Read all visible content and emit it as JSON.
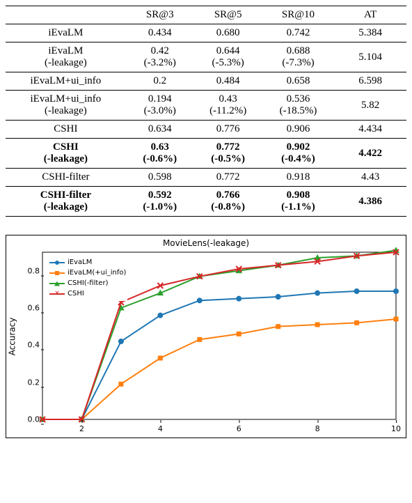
{
  "table": {
    "headers": [
      "",
      "SR@3",
      "SR@5",
      "SR@10",
      "AT"
    ],
    "rows": [
      {
        "label": "iEvaLM",
        "sub": "",
        "sr3": "0.434",
        "sr5": "0.680",
        "sr10": "0.742",
        "at": "5.384",
        "bold": false,
        "twoLine": false
      },
      {
        "label": "iEvaLM",
        "sub": "(-leakage)",
        "sr3": "0.42",
        "sr3d": "(-3.2%)",
        "sr5": "0.644",
        "sr5d": "(-5.3%)",
        "sr10": "0.688",
        "sr10d": "(-7.3%)",
        "at": "5.104",
        "bold": false,
        "twoLine": true
      },
      {
        "label": "iEvaLM+ui_info",
        "sub": "",
        "sr3": "0.2",
        "sr5": "0.484",
        "sr10": "0.658",
        "at": "6.598",
        "bold": false,
        "twoLine": false
      },
      {
        "label": "iEvaLM+ui_info",
        "sub": "(-leakage)",
        "sr3": "0.194",
        "sr3d": "(-3.0%)",
        "sr5": "0.43",
        "sr5d": "(-11.2%)",
        "sr10": "0.536",
        "sr10d": "(-18.5%)",
        "at": "5.82",
        "bold": false,
        "twoLine": true
      },
      {
        "label": "CSHI",
        "sub": "",
        "sr3": "0.634",
        "sr5": "0.776",
        "sr10": "0.906",
        "at": "4.434",
        "bold": false,
        "twoLine": false
      },
      {
        "label": "CSHI",
        "sub": "(-leakage)",
        "sr3": "0.63",
        "sr3d": "(-0.6%)",
        "sr5": "0.772",
        "sr5d": "(-0.5%)",
        "sr10": "0.902",
        "sr10d": "(-0.4%)",
        "at": "4.422",
        "bold": true,
        "twoLine": true
      },
      {
        "label": "CSHI-filter",
        "sub": "",
        "sr3": "0.598",
        "sr5": "0.772",
        "sr10": "0.918",
        "at": "4.43",
        "bold": false,
        "twoLine": false
      },
      {
        "label": "CSHI-filter",
        "sub": "(-leakage)",
        "sr3": "0.592",
        "sr3d": "(-1.0%)",
        "sr5": "0.766",
        "sr5d": "(-0.8%)",
        "sr10": "0.908",
        "sr10d": "(-1.1%)",
        "at": "4.386",
        "bold": true,
        "twoLine": true
      }
    ]
  },
  "chart_data": {
    "type": "line",
    "title": "MovieLens(-leakage)",
    "xlabel": "",
    "ylabel": "Accuracy",
    "xlim": [
      1,
      10
    ],
    "ylim": [
      0.0,
      0.9
    ],
    "xticks": [
      2,
      4,
      6,
      8,
      10
    ],
    "yticks": [
      0.0,
      0.2,
      0.4,
      0.6,
      0.8
    ],
    "x": [
      1,
      2,
      3,
      4,
      5,
      6,
      7,
      8,
      9,
      10
    ],
    "series": [
      {
        "name": "iEvaLM",
        "color": "#1f77b4",
        "marker": "circle",
        "values": [
          0.0,
          0.0,
          0.42,
          0.56,
          0.64,
          0.65,
          0.66,
          0.68,
          0.69,
          0.69
        ]
      },
      {
        "name": "iEvaLM(+ui_info)",
        "color": "#ff7f0e",
        "marker": "square",
        "values": [
          0.0,
          0.0,
          0.19,
          0.33,
          0.43,
          0.46,
          0.5,
          0.51,
          0.52,
          0.54
        ]
      },
      {
        "name": "CSHI(-filter)",
        "color": "#2ca02c",
        "marker": "triangle",
        "values": [
          0.0,
          0.0,
          0.6,
          0.68,
          0.77,
          0.8,
          0.83,
          0.87,
          0.88,
          0.91
        ]
      },
      {
        "name": "CSHI",
        "color": "#d62728",
        "marker": "cross",
        "values": [
          0.0,
          0.0,
          0.63,
          0.72,
          0.77,
          0.81,
          0.83,
          0.85,
          0.88,
          0.9
        ]
      }
    ],
    "legend_position": "upper left"
  }
}
